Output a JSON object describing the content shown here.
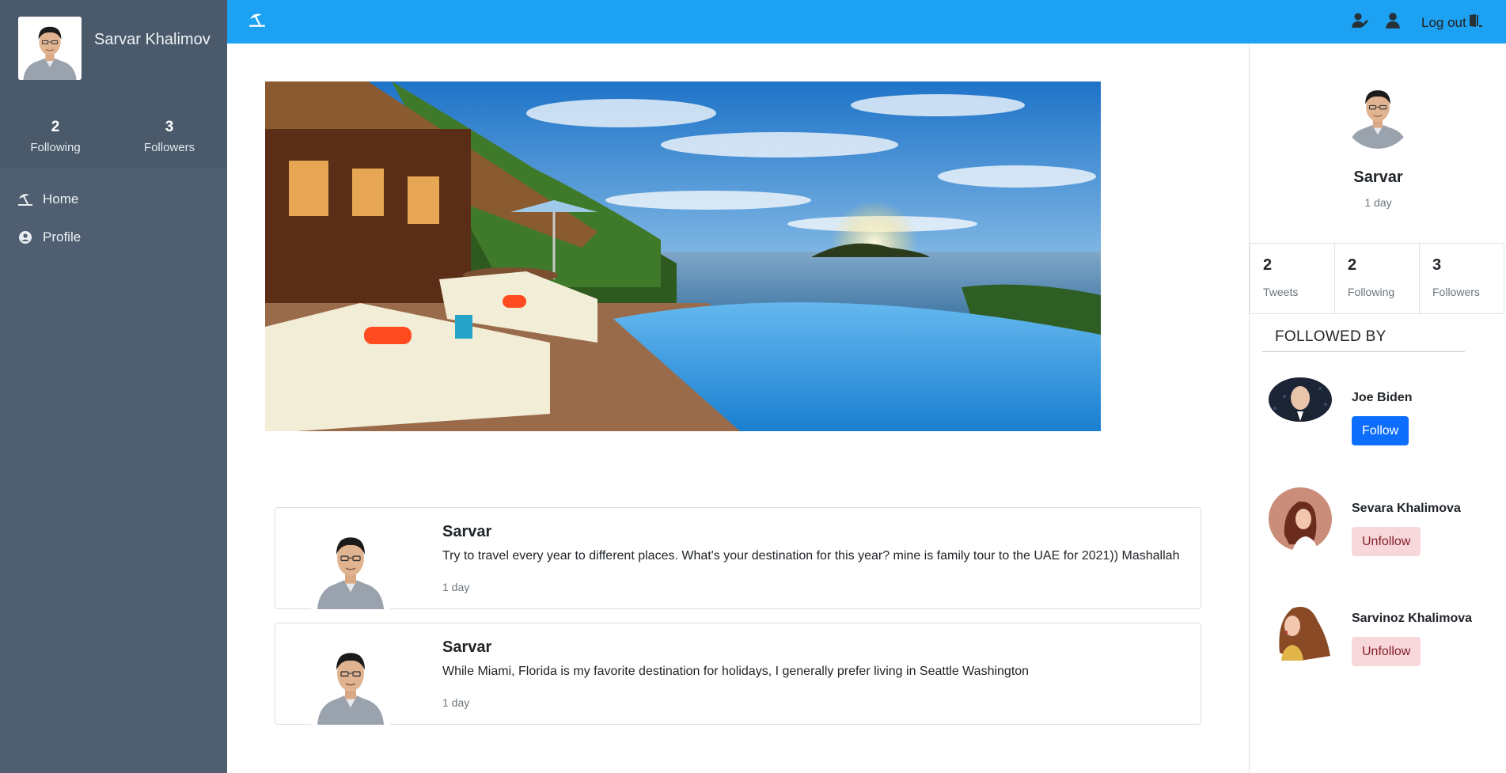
{
  "sidebar": {
    "user_name": "Sarvar Khalimov",
    "stats": [
      {
        "value": "2",
        "label": "Following"
      },
      {
        "value": "3",
        "label": "Followers"
      }
    ],
    "nav": [
      {
        "label": "Home",
        "icon": "umbrella-beach-icon"
      },
      {
        "label": "Profile",
        "icon": "user-circle-icon"
      }
    ]
  },
  "topbar": {
    "logo_icon": "umbrella-beach-icon",
    "logout_label": "Log out",
    "accent": "#1da1f2"
  },
  "tweets": [
    {
      "author": "Sarvar",
      "text": "Try to travel every year to different places. What's your destination for this year? mine is family tour to the UAE for 2021)) Mashallah",
      "time": "1 day"
    },
    {
      "author": "Sarvar",
      "text": "While Miami, Florida is my favorite destination for holidays, I generally prefer living in Seattle Washington",
      "time": "1 day"
    }
  ],
  "profile_panel": {
    "name": "Sarvar",
    "time": "1 day",
    "stats": [
      {
        "value": "2",
        "label": "Tweets"
      },
      {
        "value": "2",
        "label": "Following"
      },
      {
        "value": "3",
        "label": "Followers"
      }
    ],
    "followed_by_title": "FOLLOWED BY",
    "followers": [
      {
        "name": "Joe Biden",
        "button": "Follow"
      },
      {
        "name": "Sevara Khalimova",
        "button": "Unfollow"
      },
      {
        "name": "Sarvinoz Khalimova",
        "button": "Unfollow"
      }
    ]
  }
}
